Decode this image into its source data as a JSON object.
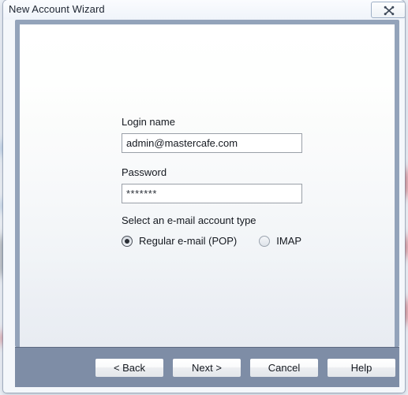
{
  "window": {
    "title": "New Account Wizard",
    "close_icon": "close-icon"
  },
  "form": {
    "login_label": "Login name",
    "login_value": "admin@mastercafe.com",
    "login_placeholder": "",
    "password_label": "Password",
    "password_value": "*******",
    "password_placeholder": "",
    "account_type_label": "Select an e-mail account type",
    "options": [
      {
        "label": "Regular e-mail (POP)",
        "selected": true
      },
      {
        "label": "IMAP",
        "selected": false
      }
    ]
  },
  "footer": {
    "back_label": "< Back",
    "next_label": "Next >",
    "cancel_label": "Cancel",
    "help_label": "Help"
  },
  "colors": {
    "frame": "#93a3ba",
    "footer_bar": "#7e8da6",
    "content_top": "#ffffff",
    "content_bottom": "#e8ecf2",
    "text": "#14181f"
  }
}
